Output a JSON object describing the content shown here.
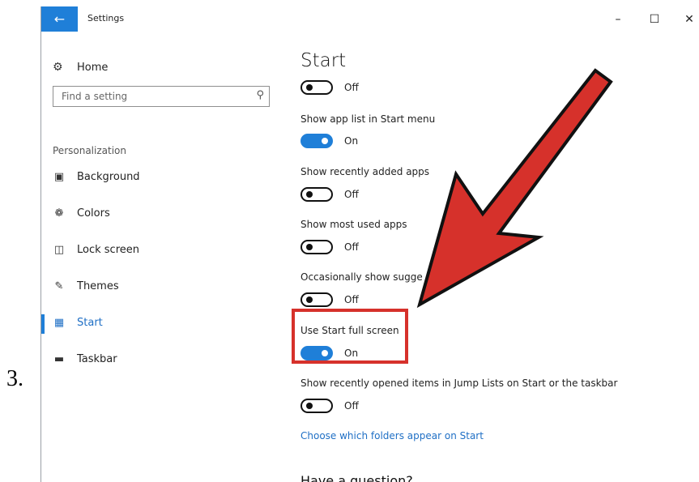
{
  "step_number": "3.",
  "window": {
    "title": "Settings",
    "controls": {
      "minimize": "–",
      "maximize": "☐",
      "close": "✕"
    }
  },
  "sidebar": {
    "home": "Home",
    "search_placeholder": "Find a setting",
    "section": "Personalization",
    "items": [
      {
        "label": "Background",
        "icon": "picture-icon"
      },
      {
        "label": "Colors",
        "icon": "palette-icon"
      },
      {
        "label": "Lock screen",
        "icon": "lock-screen-icon"
      },
      {
        "label": "Themes",
        "icon": "themes-icon"
      },
      {
        "label": "Start",
        "icon": "start-icon",
        "active": true
      },
      {
        "label": "Taskbar",
        "icon": "taskbar-icon"
      }
    ]
  },
  "content": {
    "title": "Start",
    "first_toggle_state": "Off",
    "settings": [
      {
        "label": "Show app list in Start menu",
        "state": "On"
      },
      {
        "label": "Show recently added apps",
        "state": "Off"
      },
      {
        "label": "Show most used apps",
        "state": "Off"
      },
      {
        "label": "Occasionally show sugge",
        "state": "Off"
      },
      {
        "label": "Use Start full screen",
        "state": "On"
      },
      {
        "label": "Show recently opened items in Jump Lists on Start or the taskbar",
        "state": "Off"
      }
    ],
    "link": "Choose which folders appear on Start",
    "question": "Have a question?"
  },
  "colors": {
    "accent": "#1f7fd8",
    "annotation": "#d6312b"
  }
}
